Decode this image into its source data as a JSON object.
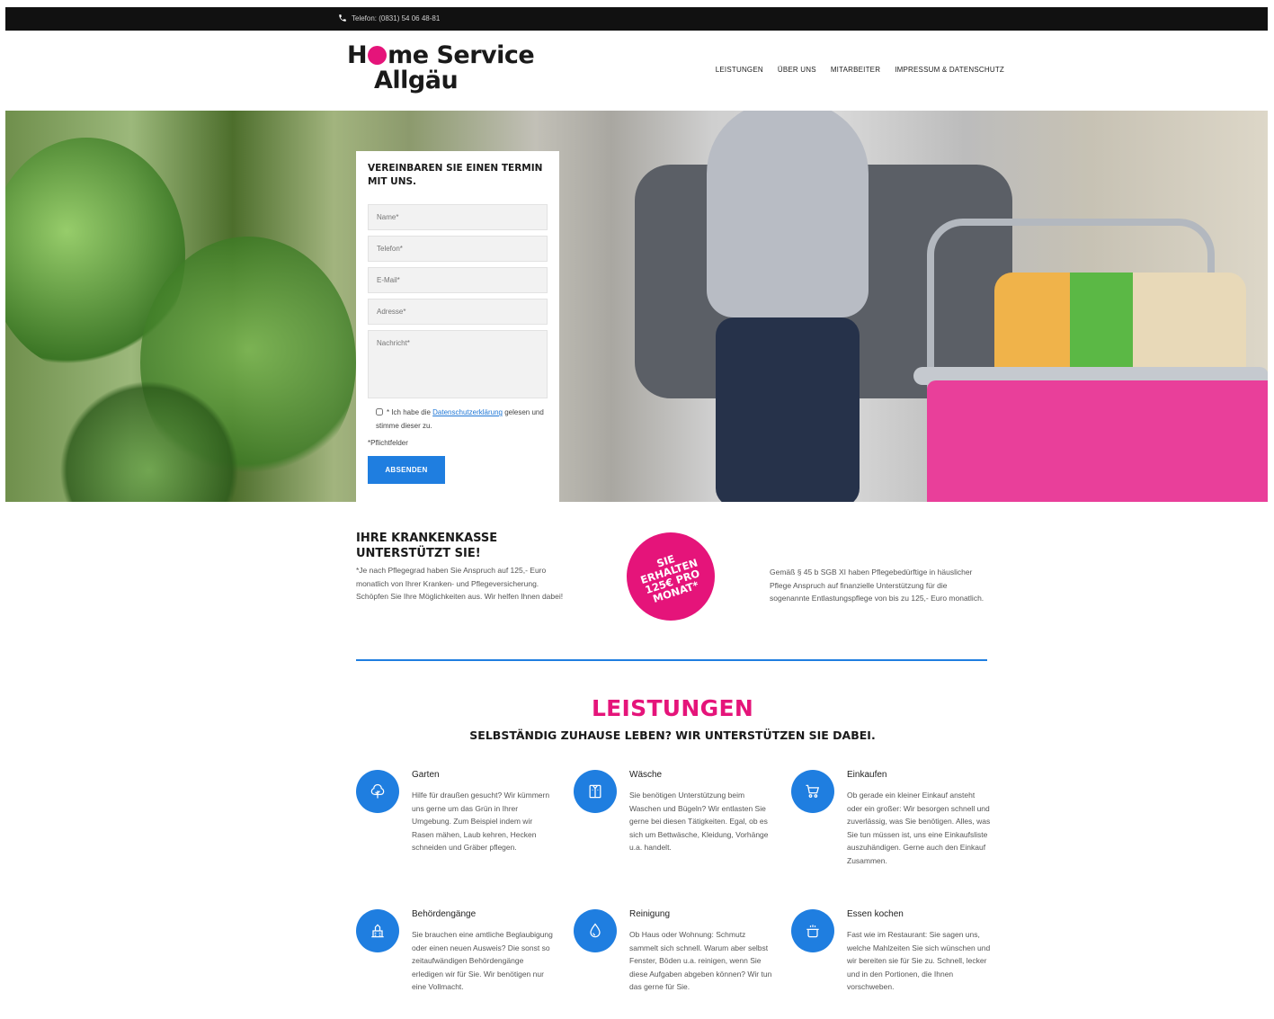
{
  "topbar": {
    "phone": "Telefon: (0831) 54 06 48-81"
  },
  "logo": {
    "line1_a": "H",
    "line1_b": "me Service",
    "line2": "Allgäu"
  },
  "nav": [
    "LEISTUNGEN",
    "ÜBER UNS",
    "MITARBEITER",
    "IMPRESSUM & DATENSCHUTZ"
  ],
  "form": {
    "title": "VEREINBAREN SIE EINEN TERMIN MIT UNS.",
    "fields": {
      "name": "Name*",
      "telefon": "Telefon*",
      "email": "E-Mail*",
      "adresse": "Adresse*",
      "nachricht": "Nachricht*"
    },
    "consent_prefix": "* Ich habe die ",
    "consent_link": "Datenschutzerklärung",
    "consent_suffix": " gelesen und stimme dieser zu.",
    "required_note": "*Pflichtfelder",
    "submit": "ABSENDEN"
  },
  "insurance": {
    "title": "IHRE KRANKENKASSE UNTERSTÜTZT SIE!",
    "text": "*Je nach Pflegegrad haben Sie Anspruch auf 125,- Euro monatlich von Ihrer Kranken- und Pflegeversicherung. Schöpfen Sie Ihre Möglichkeiten aus. Wir helfen Ihnen dabei!",
    "badge": "SIE ERHALTEN 125€ PRO MONAT*",
    "right_text": "Gemäß § 45 b SGB XI haben Pflegebedürftige in häuslicher Pflege Anspruch auf finanzielle Unterstützung für die sogenannte Entlastungspflege von bis zu 125,- Euro monatlich."
  },
  "services": {
    "title": "LEISTUNGEN",
    "subtitle": "SELBSTÄNDIG ZUHAUSE LEBEN? WIR UNTERSTÜTZEN SIE DABEI.",
    "items": [
      {
        "icon": "tree-icon",
        "title": "Garten",
        "text": "Hilfe für draußen gesucht? Wir kümmern uns gerne um das Grün in Ihrer Umgebung. Zum Beispiel indem wir Rasen mähen, Laub kehren, Hecken schneiden und Gräber pflegen."
      },
      {
        "icon": "shirt-icon",
        "title": "Wäsche",
        "text": "Sie benötigen Unterstützung beim Waschen und Bügeln? Wir entlasten Sie gerne bei diesen Tätigkeiten. Egal, ob es sich um Bettwäsche, Kleidung, Vorhänge u.a. handelt."
      },
      {
        "icon": "cart-icon",
        "title": "Einkaufen",
        "text": "Ob gerade ein kleiner Einkauf ansteht oder ein großer: Wir besorgen schnell und zuverlässig, was Sie benötigen. Alles, was Sie tun müssen ist, uns eine Einkaufsliste auszuhändigen. Gerne auch den Einkauf Zusammen."
      },
      {
        "icon": "building-icon",
        "title": "Behördengänge",
        "text": "Sie brauchen eine amtliche Beglaubigung oder einen neuen Ausweis? Die sonst so zeitaufwändigen Behördengänge erledigen wir für Sie. Wir benötigen nur eine Vollmacht."
      },
      {
        "icon": "drop-icon",
        "title": "Reinigung",
        "text": "Ob Haus oder Wohnung: Schmutz sammelt sich schnell. Warum aber selbst Fenster, Böden u.a. reinigen, wenn Sie diese Aufgaben abgeben können? Wir tun das gerne für Sie."
      },
      {
        "icon": "pot-icon",
        "title": "Essen kochen",
        "text": "Fast wie im Restaurant: Sie sagen uns, welche Mahlzeiten Sie sich wünschen und wir bereiten sie für Sie zu. Schnell, lecker und in den Portionen, die Ihnen vorschweben."
      }
    ]
  },
  "colors": {
    "accent_pink": "#e5147a",
    "accent_blue": "#1f7ee0",
    "topbar": "#111111"
  }
}
